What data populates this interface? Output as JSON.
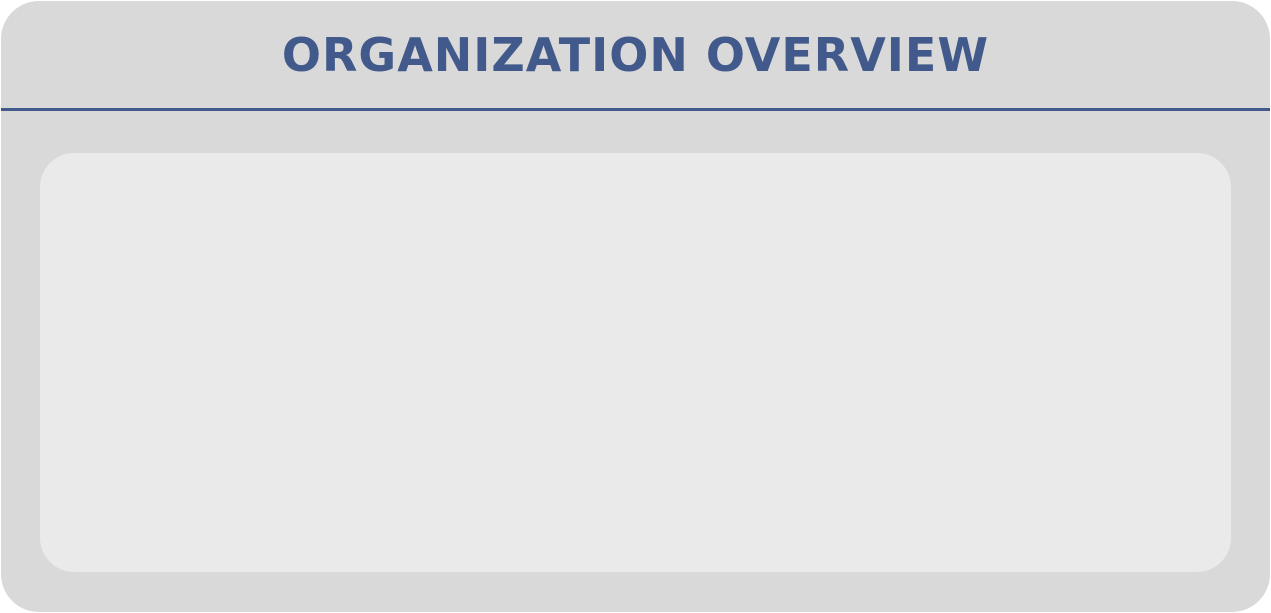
{
  "panel": {
    "title": "ORGANIZATION OVERVIEW"
  },
  "colors": {
    "accent": "#425a8b",
    "panel_background": "#d9d9d9",
    "content_background": "#eaeaea"
  }
}
